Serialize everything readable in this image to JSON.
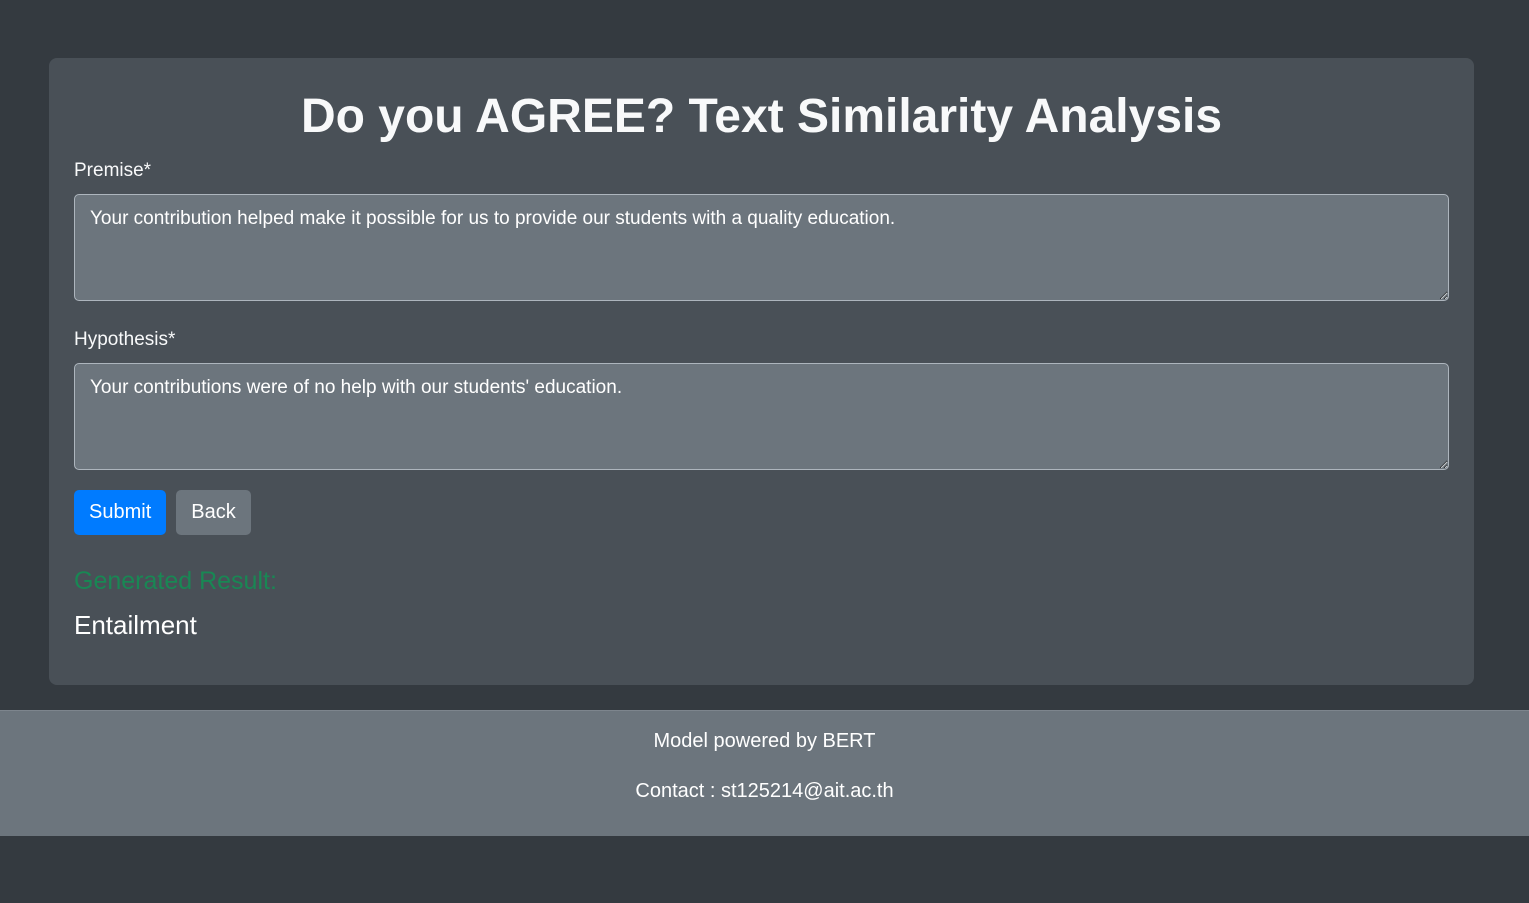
{
  "page": {
    "title": "Do you AGREE? Text Similarity Analysis"
  },
  "form": {
    "premise_label": "Premise*",
    "premise_value": "Your contribution helped make it possible for us to provide our students with a quality education.",
    "hypothesis_label": "Hypothesis*",
    "hypothesis_value": "Your contributions were of no help with our students' education.",
    "submit_label": "Submit",
    "back_label": "Back"
  },
  "result": {
    "heading": "Generated Result:",
    "value": "Entailment"
  },
  "footer": {
    "line1": "Model powered by BERT",
    "line2": "Contact : st125214@ait.ac.th"
  },
  "colors": {
    "page_background": "#343a40",
    "card_background": "#495057",
    "input_background": "#6c757d",
    "primary_button": "#007bff",
    "secondary_button": "#6c757d",
    "result_heading": "#198754",
    "footer_background": "#6c757d"
  }
}
